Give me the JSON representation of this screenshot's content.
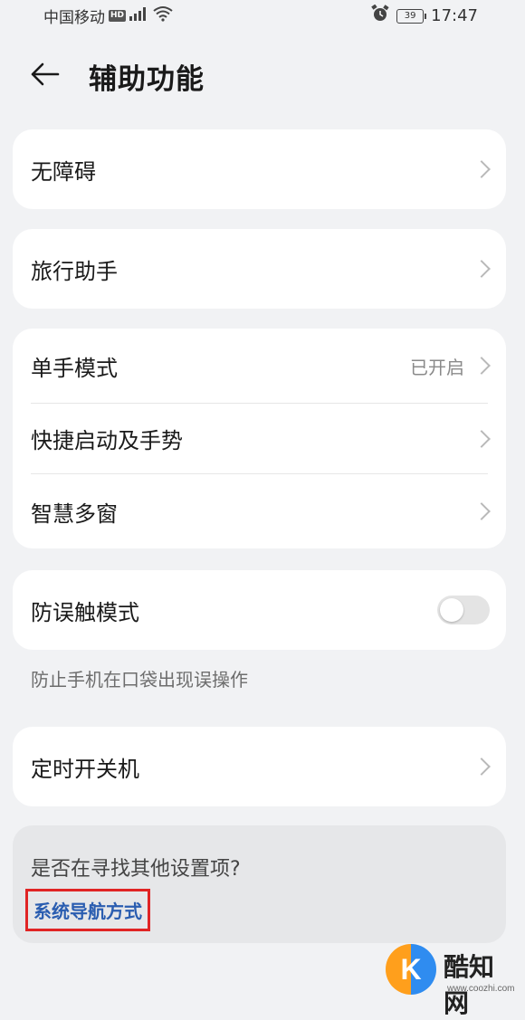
{
  "status_bar": {
    "carrier": "中国移动",
    "hd": "HD",
    "signal": "4G",
    "battery": "39",
    "time": "17:47"
  },
  "header": {
    "title": "辅助功能"
  },
  "groups": [
    {
      "items": [
        {
          "label": "无障碍"
        }
      ]
    },
    {
      "items": [
        {
          "label": "旅行助手"
        }
      ]
    },
    {
      "items": [
        {
          "label": "单手模式",
          "value": "已开启"
        },
        {
          "label": "快捷启动及手势"
        },
        {
          "label": "智慧多窗"
        }
      ]
    },
    {
      "items": [
        {
          "label": "防误触模式",
          "toggle": false
        }
      ]
    },
    {
      "items": [
        {
          "label": "定时开关机"
        }
      ]
    }
  ],
  "pocket_hint": "防止手机在口袋出现误操作",
  "suggestion": {
    "question": "是否在寻找其他设置项?",
    "link": "系统导航方式"
  },
  "watermark": {
    "logo_letter": "K",
    "name": "酷知网",
    "url": "www.coozhi.com"
  },
  "colors": {
    "highlight_border": "#e02424",
    "link": "#2a5db0"
  }
}
